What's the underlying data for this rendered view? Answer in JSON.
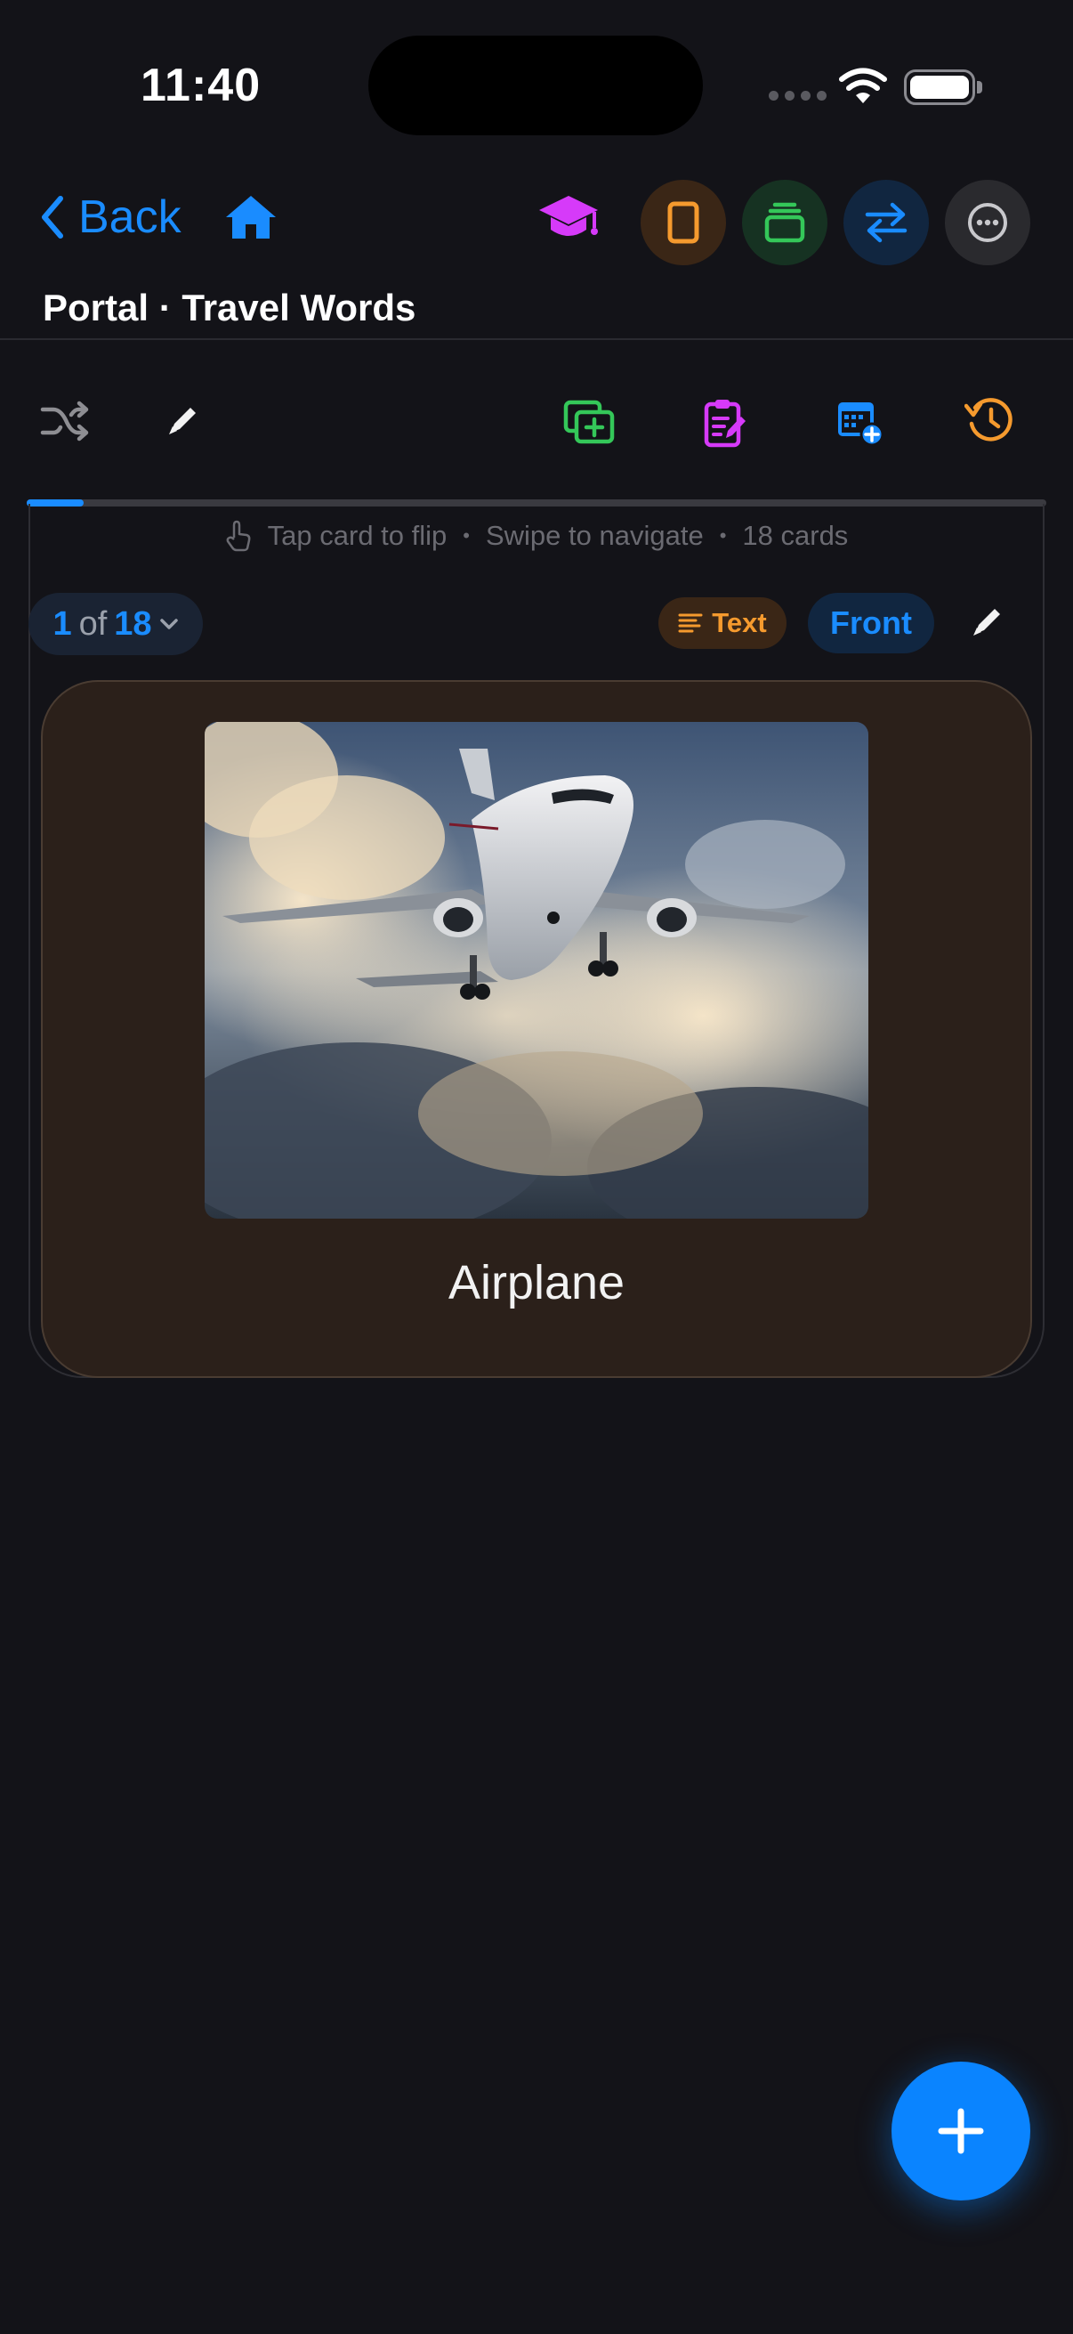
{
  "status_bar": {
    "time": "11:40"
  },
  "nav": {
    "back_label": "Back",
    "title": "Portal · Travel Words"
  },
  "hint": {
    "tap": "Tap card to flip",
    "swipe": "Swipe to navigate",
    "count": "18 cards"
  },
  "counter": {
    "current": "1",
    "of": "of",
    "total": "18"
  },
  "mode_chips": {
    "text": "Text",
    "side": "Front"
  },
  "progress": {
    "fraction": 0.0556
  },
  "card": {
    "word": "Airplane",
    "image_description": "airplane-in-clouds"
  },
  "icons": {
    "back": "chevron-left-icon",
    "home": "home-icon",
    "learn": "graduation-cap-icon",
    "phone": "phone-icon",
    "stack": "stack-icon",
    "swap": "swap-arrows-icon",
    "more": "ellipsis-circle-icon",
    "shuffle": "shuffle-icon",
    "edit": "pencil-icon",
    "add_card": "add-card-icon",
    "notes": "clipboard-edit-icon",
    "schedule": "calendar-add-icon",
    "history": "history-icon",
    "fab": "plus-icon"
  },
  "colors": {
    "accent": "#1a8cff",
    "orange": "#f59a2e",
    "green": "#34c759",
    "magenta": "#d63af9",
    "background": "#131318",
    "card": "#2b201a"
  }
}
